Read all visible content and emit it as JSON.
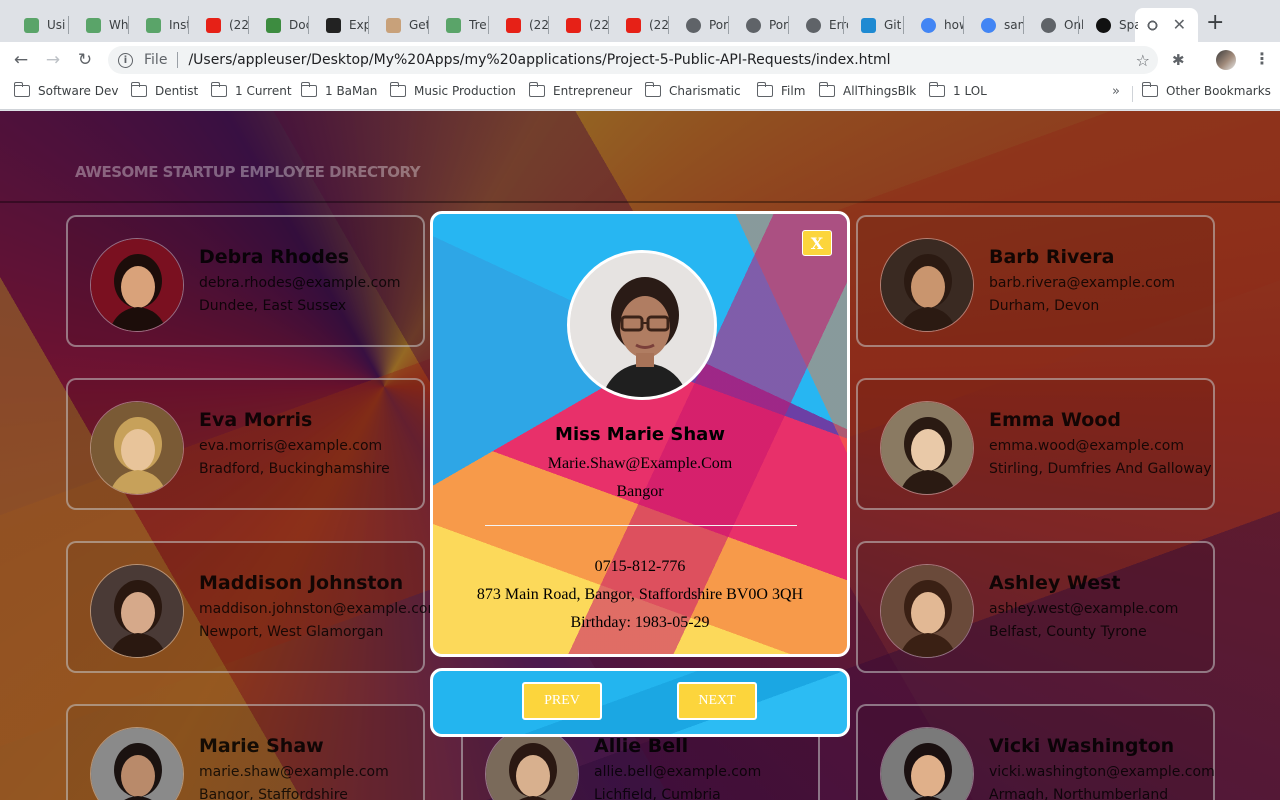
{
  "tabs": [
    {
      "title": "Usin",
      "icon": "green-leaf-icon",
      "color": "#5aa469"
    },
    {
      "title": "Wh",
      "icon": "green-leaf-icon",
      "color": "#5aa469"
    },
    {
      "title": "Inst",
      "icon": "green-leaf-icon",
      "color": "#5aa469"
    },
    {
      "title": "(22",
      "icon": "youtube-icon",
      "color": "#e62117"
    },
    {
      "title": "Doc",
      "icon": "green-cube-icon",
      "color": "#3d8c40"
    },
    {
      "title": "Exp",
      "icon": "ex-icon",
      "color": "#222222"
    },
    {
      "title": "Get",
      "icon": "pug-icon",
      "color": "#c8a17a"
    },
    {
      "title": "Tre",
      "icon": "green-leaf-icon",
      "color": "#5aa469"
    },
    {
      "title": "(22",
      "icon": "youtube-icon",
      "color": "#e62117"
    },
    {
      "title": "(22",
      "icon": "youtube-icon",
      "color": "#e62117"
    },
    {
      "title": "(22",
      "icon": "youtube-icon",
      "color": "#e62117"
    },
    {
      "title": "Por",
      "icon": "globe-icon",
      "color": "#5f6368"
    },
    {
      "title": "Por",
      "icon": "globe-icon",
      "color": "#5f6368"
    },
    {
      "title": "Erro",
      "icon": "globe-icon",
      "color": "#5f6368"
    },
    {
      "title": "Git",
      "icon": "vscode-icon",
      "color": "#1f8ad2"
    },
    {
      "title": "how",
      "icon": "google-icon",
      "color": "#4285f4"
    },
    {
      "title": "san",
      "icon": "google-icon",
      "color": "#4285f4"
    },
    {
      "title": "Onl",
      "icon": "globe-icon",
      "color": "#5f6368"
    },
    {
      "title": "Spa",
      "icon": "github-icon",
      "color": "#111111"
    }
  ],
  "active_tab": {
    "icon": "globe-icon",
    "close": "✕"
  },
  "new_tab": "+",
  "address": {
    "scheme": "File",
    "url": "/Users/appleuser/Desktop/My%20Apps/my%20applications/Project-5-Public-API-Requests/index.html"
  },
  "bookmarks": [
    "Software Dev",
    "Dentist",
    "1 Current",
    "1 BaMan",
    "Music Production",
    "Entrepreneur",
    "Charismatic",
    "Film",
    "AllThingsBlk",
    "1 LOL"
  ],
  "bookmarks_more": "»",
  "other_bookmarks": "Other Bookmarks",
  "header": {
    "title": "AWESOME STARTUP EMPLOYEE DIRECTORY"
  },
  "employees": [
    {
      "name": "Debra Rhodes",
      "email": "debra.rhodes@example.com",
      "location": "Dundee, East Sussex"
    },
    {
      "name": "Barb Rivera",
      "email": "barb.rivera@example.com",
      "location": "Durham, Devon"
    },
    {
      "name": "Eva Morris",
      "email": "eva.morris@example.com",
      "location": "Bradford, Buckinghamshire"
    },
    {
      "name": "Emma Wood",
      "email": "emma.wood@example.com",
      "location": "Stirling, Dumfries And Galloway"
    },
    {
      "name": "Maddison Johnston",
      "email": "maddison.johnston@example.com",
      "location": "Newport, West Glamorgan"
    },
    {
      "name": "Ashley West",
      "email": "ashley.west@example.com",
      "location": "Belfast, County Tyrone"
    },
    {
      "name": "Marie Shaw",
      "email": "marie.shaw@example.com",
      "location": "Bangor, Staffordshire"
    },
    {
      "name": "Allie Bell",
      "email": "allie.bell@example.com",
      "location": "Lichfield, Cumbria"
    },
    {
      "name": "Vicki Washington",
      "email": "vicki.washington@example.com",
      "location": "Armagh, Northumberland"
    }
  ],
  "modal": {
    "close": "X",
    "name": "Miss Marie Shaw",
    "email": "Marie.Shaw@Example.Com",
    "city": "Bangor",
    "phone": "0715-812-776",
    "address": "873 Main Road, Bangor, Staffordshire BV0O 3QH",
    "birthday": "Birthday: 1983-05-29"
  },
  "buttons": {
    "prev": "PREV",
    "next": "NEXT"
  }
}
